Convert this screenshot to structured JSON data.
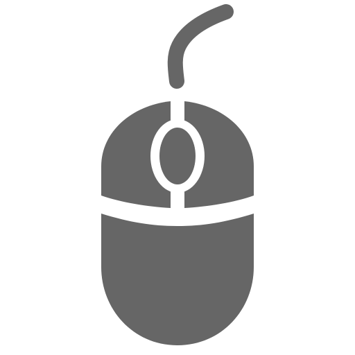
{
  "icon": {
    "name": "computer-mouse-icon",
    "color": "#666666",
    "background": "#ffffff"
  }
}
